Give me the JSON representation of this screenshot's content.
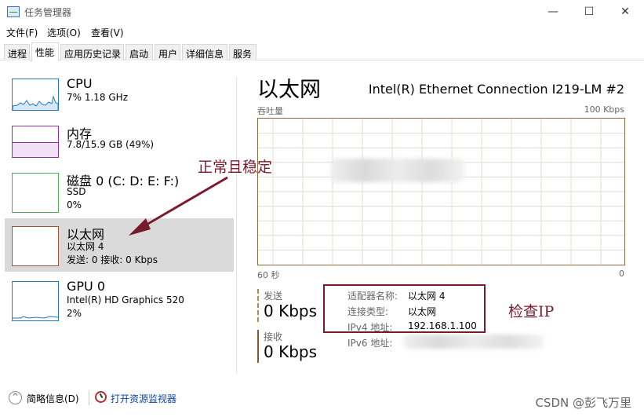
{
  "window": {
    "title": "任务管理器",
    "minimize_glyph": "—",
    "maximize_glyph": "☐",
    "close_glyph": "✕"
  },
  "menu": [
    "文件(F)",
    "选项(O)",
    "查看(V)"
  ],
  "tabs": [
    "进程",
    "性能",
    "应用历史记录",
    "启动",
    "用户",
    "详细信息",
    "服务"
  ],
  "left_items": [
    {
      "title": "CPU",
      "lines": [
        "7%  1.18 GHz"
      ],
      "color": "#1f7ac6",
      "selected": false
    },
    {
      "title": "内存",
      "lines": [
        "7.8/15.9 GB (49%)"
      ],
      "color": "#8b2fa3",
      "selected": false
    },
    {
      "title": "磁盘 0 (C: D: E: F:)",
      "lines": [
        "SSD",
        "0%"
      ],
      "color": "#4caf50",
      "selected": false
    },
    {
      "title": "以太网",
      "lines": [
        "以太网 4",
        "发送: 0 接收: 0 Kbps"
      ],
      "color": "#a0522d",
      "selected": true
    },
    {
      "title": "GPU 0",
      "lines": [
        "Intel(R) HD Graphics 520",
        "2%"
      ],
      "color": "#1f7ac6",
      "selected": false
    }
  ],
  "right": {
    "title": "以太网",
    "adapter": "Intel(R) Ethernet Connection I219-LM #2",
    "throughput_label": "吞吐量",
    "scale_max": "100 Kbps",
    "x_left": "60 秒",
    "x_right": "0",
    "send_label": "发送",
    "send_value": "0 Kbps",
    "recv_label": "接收",
    "recv_value": "0 Kbps",
    "details": [
      {
        "label": "适配器名称:",
        "value": "以太网 4"
      },
      {
        "label": "连接类型:",
        "value": "以太网"
      },
      {
        "label": "IPv4 地址:",
        "value": "192.168.1.100"
      },
      {
        "label": "IPv6 地址:",
        "value": ""
      }
    ]
  },
  "annotations": {
    "stable": "正常且稳定",
    "check_ip": "检查IP"
  },
  "footer": {
    "brief_glyph": "^",
    "brief": "简略信息(D)",
    "monitor_link": "打开资源监视器",
    "watermark": "CSDN @彭飞万里"
  }
}
